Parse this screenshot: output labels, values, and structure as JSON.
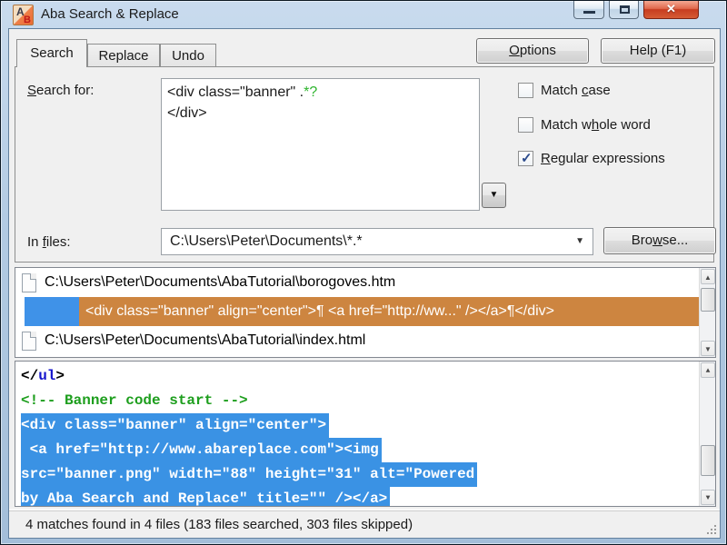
{
  "window": {
    "title": "Aba Search & Replace",
    "icon_letter_a": "A",
    "icon_letter_b": "B",
    "close_glyph": "✕"
  },
  "tabs": [
    {
      "label": "Search",
      "active": true
    },
    {
      "label": "Replace",
      "active": false
    },
    {
      "label": "Undo",
      "active": false
    }
  ],
  "header_buttons": {
    "options_parts": [
      "",
      "O",
      "ptions"
    ],
    "help": "Help (F1)"
  },
  "search_for": {
    "label_parts": [
      "",
      "S",
      "earch for:"
    ],
    "line1_text": "<div class=\"banner\" .",
    "line1_regex": "*?",
    "line2": "</div>",
    "dropdown_glyph": "▼"
  },
  "checkboxes": [
    {
      "label_parts": [
        "Match ",
        "c",
        "ase"
      ],
      "checked": false,
      "glyph": ""
    },
    {
      "label_parts": [
        "Match w",
        "h",
        "ole word"
      ],
      "checked": false,
      "glyph": ""
    },
    {
      "label_parts": [
        "",
        "R",
        "egular expressions"
      ],
      "checked": true,
      "glyph": "✓"
    }
  ],
  "in_files": {
    "label_parts": [
      "In ",
      "f",
      "iles:"
    ],
    "value": "C:\\Users\\Peter\\Documents\\*.*",
    "dropdown_glyph": "▼",
    "browse_parts": [
      "Bro",
      "w",
      "se..."
    ]
  },
  "results": {
    "rows": [
      {
        "type": "file",
        "text": "C:\\Users\\Peter\\Documents\\AbaTutorial\\borogoves.htm"
      },
      {
        "type": "match",
        "text": "<div class=\"banner\" align=\"center\">¶ <a href=\"http://ww...\" /></a>¶</div>"
      },
      {
        "type": "file",
        "text": "C:\\Users\\Peter\\Documents\\AbaTutorial\\index.html"
      }
    ]
  },
  "preview": {
    "line1_open": "</",
    "line1_tag": "ul",
    "line1_close": ">",
    "line2": "<!-- Banner code start -->",
    "line3": "<div class=\"banner\" align=\"center\">",
    "line4": " <a href=\"http://www.abareplace.com\"><img",
    "line5": "src=\"banner.png\" width=\"88\" height=\"31\" alt=\"Powered",
    "line6": "by Aba Search and Replace\" title=\"\" /></a>"
  },
  "status_bar": {
    "text": "4 matches found in 4 files (183 files searched, 303 files skipped)"
  },
  "scrollbar_glyphs": {
    "up": "▲",
    "down": "▼"
  },
  "colors": {
    "match_highlight_orange": "#cd8540",
    "selection_blue": "#3f92e8",
    "preview_selection_blue": "#3a92e4",
    "comment_green": "#1d9e1d",
    "tag_blue": "#1414cc",
    "regex_green": "#2db42d",
    "close_button_red": "#c73c20",
    "titlebar_blue": "#b3cbe3"
  }
}
